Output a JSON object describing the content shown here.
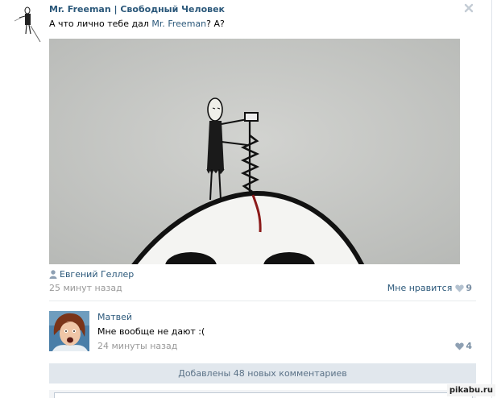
{
  "post": {
    "author": "Mr. Freeman | Свободный Человек",
    "text_prefix": "А что лично тебе дал ",
    "text_link": "Mr. Freeman",
    "text_suffix": "? А?",
    "shared_by": "Евгений Геллер",
    "time": "25 минут назад",
    "like_label": "Мне нравится",
    "like_count": "9"
  },
  "comment": {
    "author": "Матвей",
    "text": "Мне вообще не дают :(",
    "time": "24 минуты назад",
    "like_count": "4"
  },
  "more_comments": "Добавлены 48 новых комментариев",
  "watermark": "pikabu.ru",
  "icons": {
    "close": "close-icon",
    "person": "person-icon",
    "heart": "heart-icon"
  },
  "colors": {
    "link": "#2b587a",
    "meta": "#999999",
    "bar": "#e1e7ed",
    "heart": "#b4c2d0",
    "blood": "#8b1a1a"
  }
}
